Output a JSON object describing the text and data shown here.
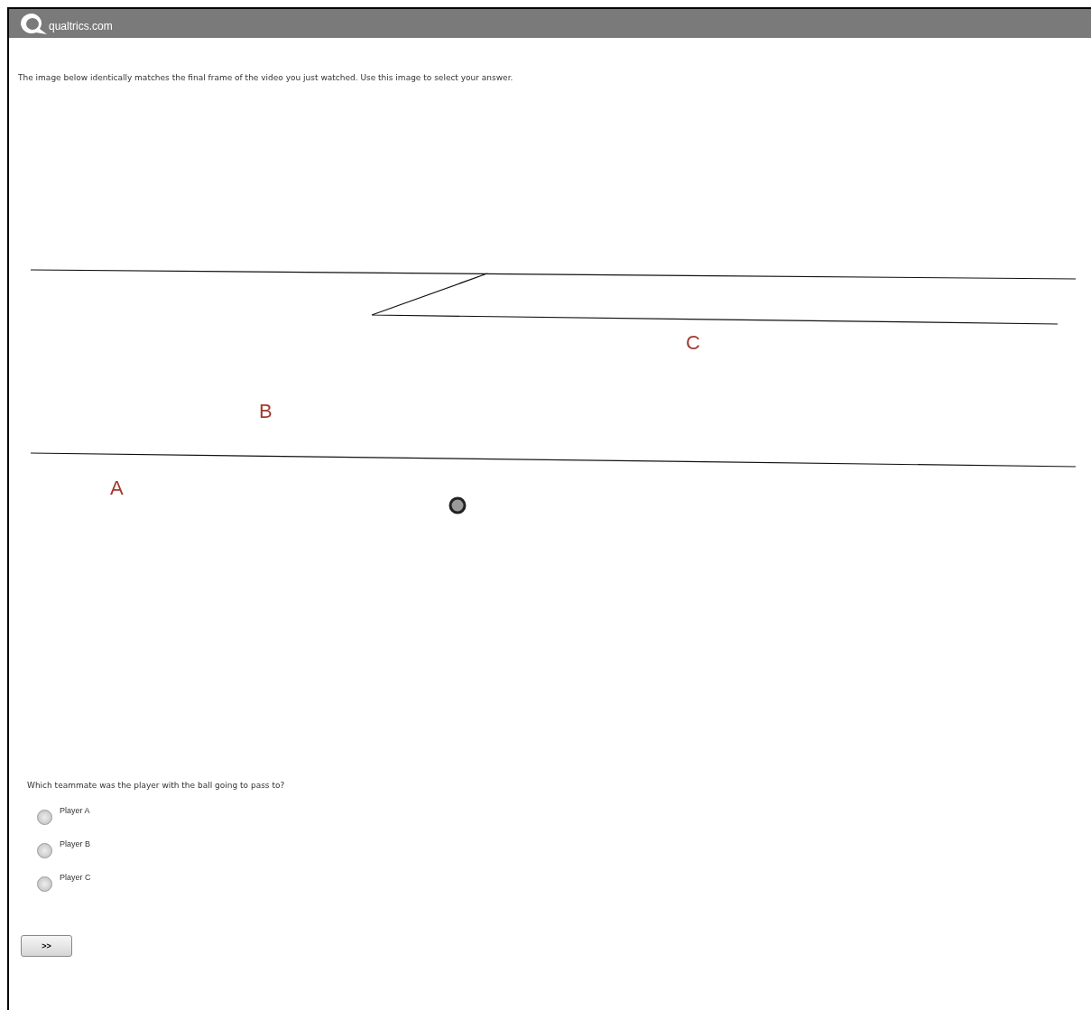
{
  "header": {
    "logo_text": "qualtrics.com"
  },
  "intro": "The image below identically matches the final frame of the video you just watched. Use this image to select your answer.",
  "diagram": {
    "labels": [
      "C",
      "B",
      "A"
    ]
  },
  "question": "Which teammate was the player with the ball going to pass to?",
  "options": [
    {
      "label": "Player A",
      "selected": false
    },
    {
      "label": "Player B",
      "selected": false
    },
    {
      "label": "Player C",
      "selected": false
    }
  ],
  "next_button": ">>"
}
